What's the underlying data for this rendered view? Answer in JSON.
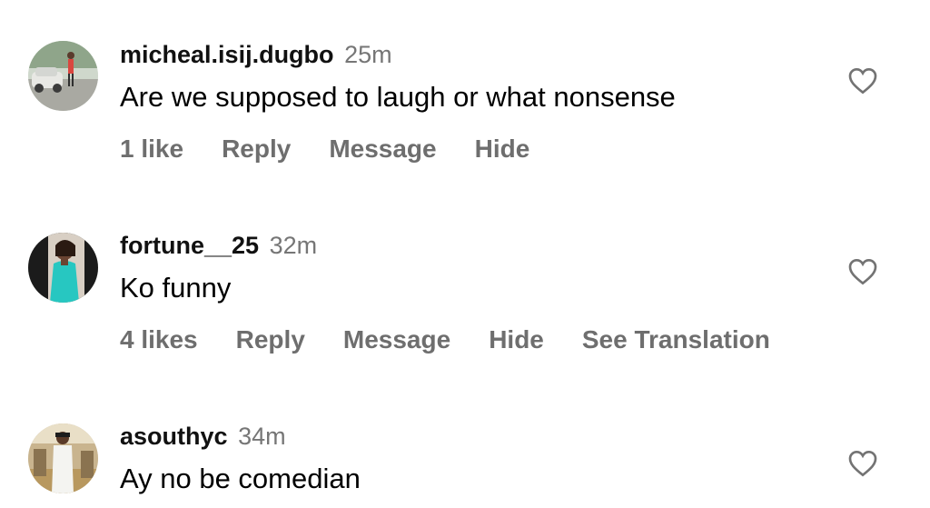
{
  "comments": [
    {
      "username": "micheal.isij.dugbo",
      "time": "25m",
      "text": "Are we supposed to laugh or what nonsense",
      "likes": "1 like",
      "reply": "Reply",
      "message": "Message",
      "hide": "Hide",
      "see_translation": ""
    },
    {
      "username": "fortune__25",
      "time": "32m",
      "text": "Ko funny",
      "likes": "4 likes",
      "reply": "Reply",
      "message": "Message",
      "hide": "Hide",
      "see_translation": "See Translation"
    },
    {
      "username": "asouthyc",
      "time": "34m",
      "text": "Ay no be comedian"
    }
  ],
  "icons": {
    "like": "heart-outline-icon"
  },
  "colors": {
    "username": "#111111",
    "meta": "#767676",
    "actions": "#6e6e6e",
    "text": "#000000"
  }
}
